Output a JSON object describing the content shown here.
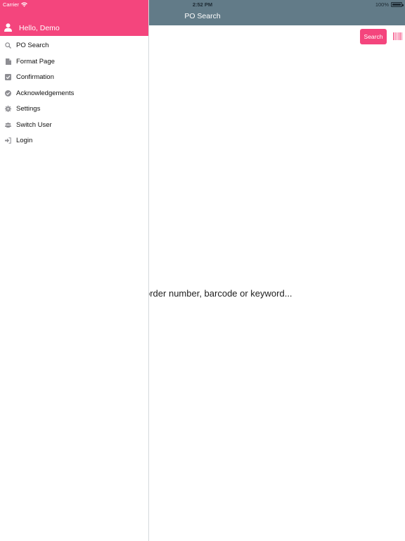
{
  "status_bar": {
    "carrier": "Carrier",
    "time": "2:52 PM",
    "battery": "100%"
  },
  "nav": {
    "title": "PO Search"
  },
  "main": {
    "search_button": "Search",
    "placeholder": "order number, barcode or keyword..."
  },
  "drawer": {
    "greeting": "Hello, Demo",
    "items": [
      {
        "label": "PO Search",
        "icon": "search-icon"
      },
      {
        "label": "Format Page",
        "icon": "document-icon"
      },
      {
        "label": "Confirmation",
        "icon": "checkbox-icon"
      },
      {
        "label": "Acknowledgements",
        "icon": "check-circle-icon"
      },
      {
        "label": "Settings",
        "icon": "gear-icon"
      },
      {
        "label": "Switch User",
        "icon": "users-icon"
      },
      {
        "label": "Login",
        "icon": "sign-in-icon"
      }
    ]
  },
  "colors": {
    "accent": "#f4457d",
    "nav_bar": "#627b88",
    "icon_gray": "#8e8e93"
  }
}
